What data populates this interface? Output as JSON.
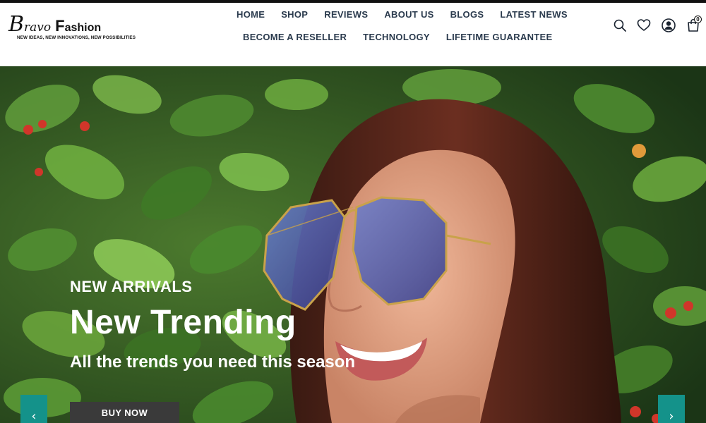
{
  "brand": {
    "logo_initial": "B",
    "logo_rest": "ravo",
    "logo_second_initial": "F",
    "logo_second_rest": "ashion",
    "tagline": "NEW IDEAS, NEW INNOVATIONS, NEW POSSIBILITIES"
  },
  "nav": {
    "row1": [
      "HOME",
      "SHOP",
      "REVIEWS",
      "ABOUT US",
      "BLOGS",
      "LATEST NEWS"
    ],
    "row2": [
      "BECOME A RESELLER",
      "TECHNOLOGY",
      "LIFETIME GUARANTEE"
    ]
  },
  "header_icons": {
    "search": "search-icon",
    "wishlist": "heart-icon",
    "account": "user-icon",
    "cart": "shopping-bag-icon",
    "cart_count": "0"
  },
  "hero": {
    "subtitle": "NEW ARRIVALS",
    "headline": "New Trending",
    "tagline": "All the trends you need this season",
    "cta_label": "BUY NOW",
    "prev_arrow": "‹",
    "next_arrow": "›"
  },
  "colors": {
    "nav_text": "#2b3b4e",
    "arrow_bg": "#14928a",
    "button_bg": "#3a3a3a"
  }
}
